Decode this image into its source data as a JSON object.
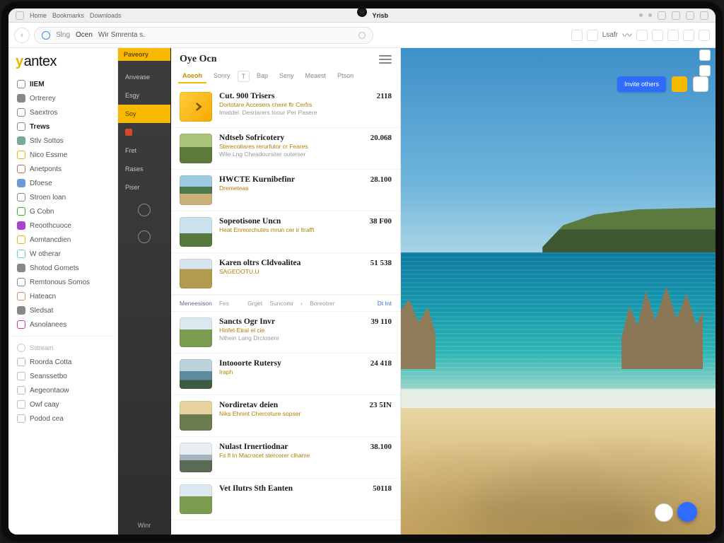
{
  "os_tabs": [
    "Home",
    "Bookmarks",
    "Downloads"
  ],
  "window_title": "Yrisb",
  "address_bar": {
    "hint": "Slng",
    "label": "Ocen",
    "url": "Wir Smrenta s."
  },
  "topbar_label": "Lsafr",
  "primary_button": "Invite others",
  "sidebar": {
    "logo_y": "y",
    "logo_rest": "antex",
    "main": [
      {
        "label": "IIEM",
        "bold": true
      },
      {
        "label": "Ortrerey"
      },
      {
        "label": "Saextros"
      },
      {
        "label": "Trews",
        "bold": true
      },
      {
        "label": "Stlv Sottos"
      },
      {
        "label": "Nico Essme"
      },
      {
        "label": "Anetponts"
      },
      {
        "label": "Dfoese"
      },
      {
        "label": "Stroen loan"
      },
      {
        "label": "G Cobn"
      },
      {
        "label": "Reoothcuoce"
      },
      {
        "label": "Aomtancdien"
      },
      {
        "label": "W otherar"
      },
      {
        "label": "Shotod Gomets"
      },
      {
        "label": "Remtonous Somos"
      },
      {
        "label": "Hateacn"
      },
      {
        "label": "Sledsat"
      },
      {
        "label": "Asnolanees"
      }
    ],
    "section_header": "Sstream",
    "secondary": [
      {
        "label": "Roorda Cotta"
      },
      {
        "label": "Seanssetbo"
      },
      {
        "label": "Aegeontaow"
      },
      {
        "label": "Owf caay"
      },
      {
        "label": "Podod cea"
      }
    ]
  },
  "rail": {
    "header": "Paveory",
    "items": [
      {
        "label": "Anvease"
      },
      {
        "label": "Esgy"
      },
      {
        "label": "Soy",
        "active": true
      },
      {
        "label": "",
        "red": true
      },
      {
        "label": "Fret"
      },
      {
        "label": "Rases"
      },
      {
        "label": "Piser"
      }
    ],
    "footer": "Winr"
  },
  "panel": {
    "title": "Oye Ocn",
    "tabs": [
      {
        "label": "Aoeoh",
        "active": true
      },
      {
        "label": "Sonry"
      },
      {
        "label": "T",
        "pill": true
      },
      {
        "label": "Bap"
      },
      {
        "label": "Seny"
      },
      {
        "label": "Meaest"
      },
      {
        "label": "Ptson"
      }
    ],
    "group_a": [
      {
        "title": "Cut. 900 Trisers",
        "sub": "Dortotare Accesers chere ftr Cerfrs",
        "desc": "Imatdel. Desriarers toour Per Pasere",
        "value": "2118",
        "thumb": "brand"
      },
      {
        "title": "Ndtseb Sofricotery",
        "sub": "Sterecotiares rerurfutor cr Feares",
        "desc": "Wile Lng Cheadoursiter outerser",
        "value": "20.068",
        "thumb": "green"
      },
      {
        "title": "HWCTE Kurnibefinr",
        "sub": "Dremeteas",
        "desc": "",
        "value": "28.100",
        "thumb": "coast"
      },
      {
        "title": "Sopeotisone Uncn",
        "sub": "Heat Enmorchutes mrun cer ir ltrafft",
        "desc": "",
        "value": "38 F00",
        "thumb": "blue"
      },
      {
        "title": "Karen oltrs Cldvoalitea",
        "sub": "SAGEOOTU.U",
        "desc": "",
        "value": "51 538",
        "thumb": "hill"
      }
    ],
    "midbar": {
      "left": "Meneesison",
      "tag": "Fes",
      "options": [
        "Grget",
        "Suncomr",
        "Boreotrer"
      ],
      "right": "Dt Int"
    },
    "group_b": [
      {
        "title": "Sancts Ogr Invr",
        "sub": "Hinfet Etral el cie",
        "desc": "Nthein Lang Drctosenr",
        "value": "39 110",
        "thumb": "field"
      },
      {
        "title": "Intooorte Rutersy",
        "sub": "Iraph",
        "desc": "",
        "value": "24 418",
        "thumb": "lake"
      },
      {
        "title": "Nordiretav deien",
        "sub": "Niks Ehnint Chercoture sopser",
        "desc": "",
        "value": "23 5IN",
        "thumb": "sunset"
      },
      {
        "title": "Nulast Irnertiodnar",
        "sub": "Fs fl In Macrocet stercorer clhame",
        "desc": "",
        "value": "38.100",
        "thumb": "mtn"
      },
      {
        "title": "Vet Ilutrs Sth Eanten",
        "sub": "",
        "desc": "",
        "value": "50118",
        "thumb": "field"
      }
    ]
  },
  "colors": {
    "accent": "#f6b900",
    "primary": "#2f6bff"
  }
}
